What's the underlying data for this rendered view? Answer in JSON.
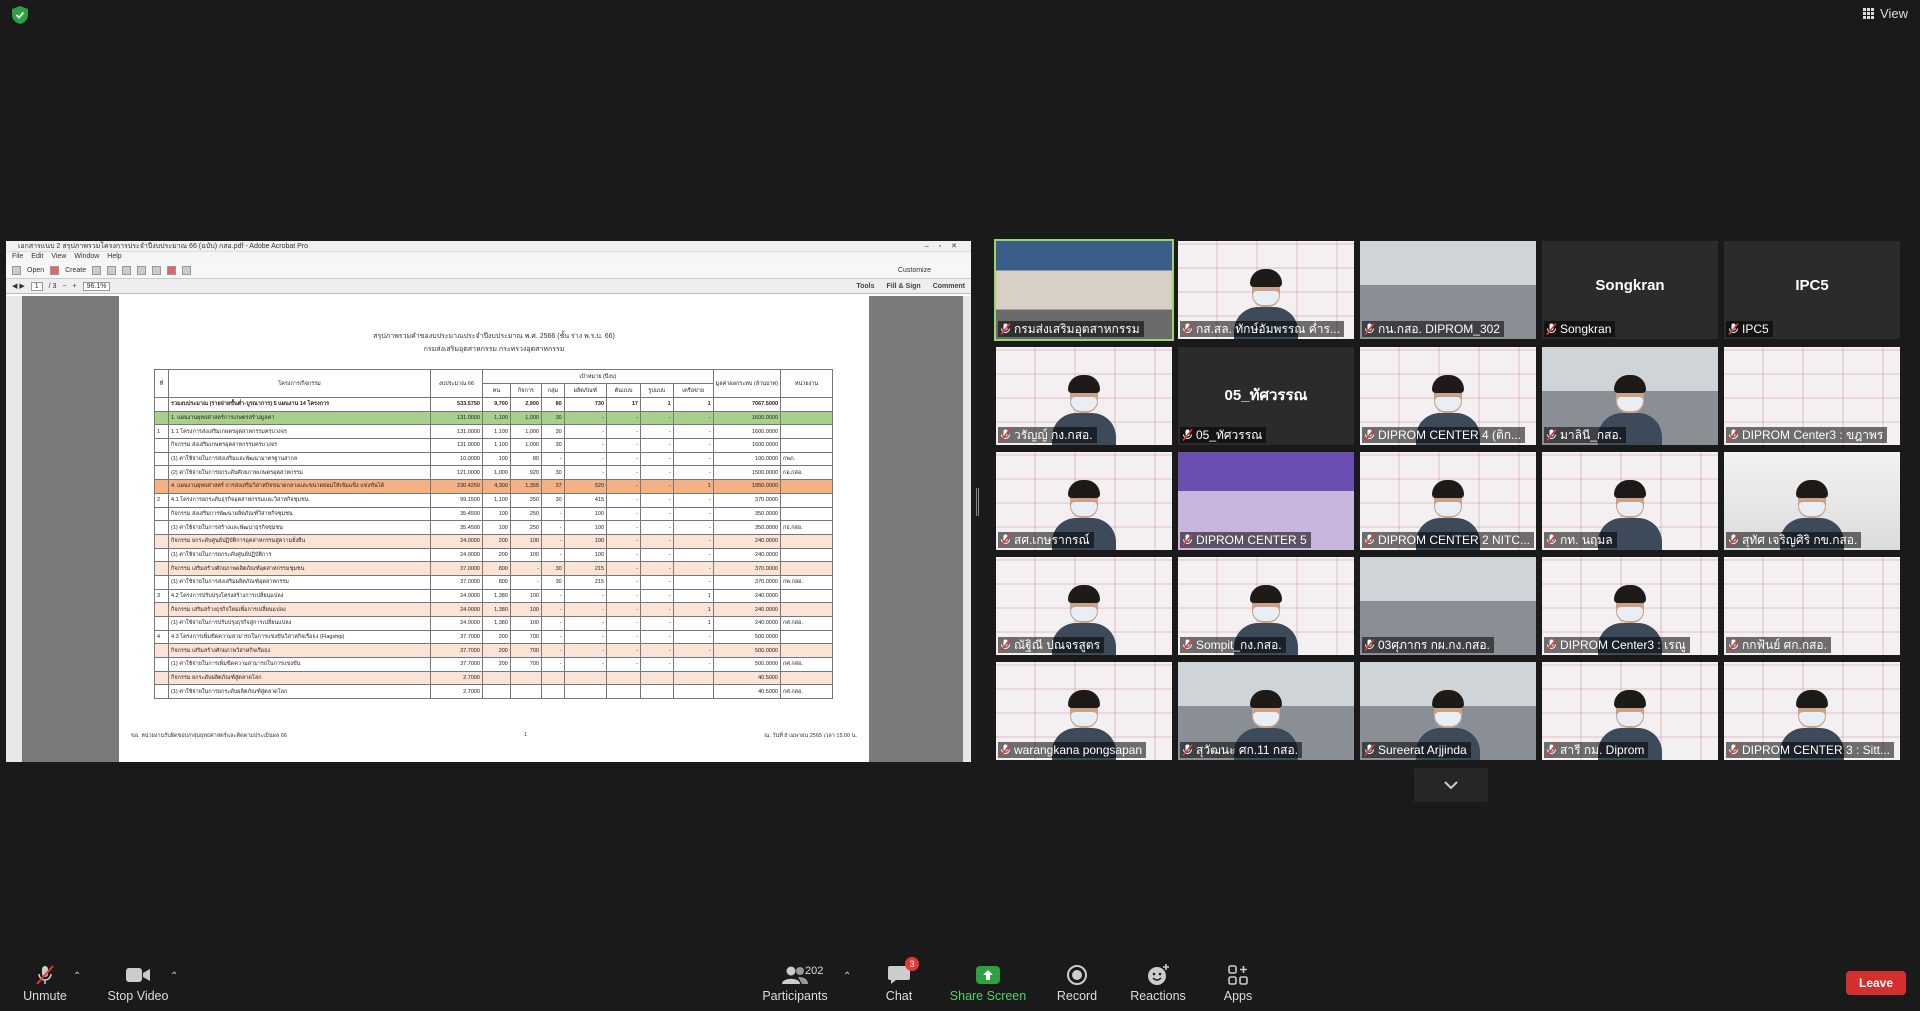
{
  "top": {
    "view_label": "View",
    "accent": "#2ea043"
  },
  "acrobat": {
    "title": "เอกสารแนบ 2 สรุปภาพรวมโครงการประจำปีงบประมาณ 66 (ฉบับ) กสอ.pdf - Adobe Acrobat Pro",
    "menu": [
      "File",
      "Edit",
      "View",
      "Window",
      "Help"
    ],
    "open_label": "Open",
    "create_label": "Create",
    "customize_label": "Customize",
    "page_current": "1",
    "page_total": "/ 3",
    "zoom": "96.1%",
    "tabs": [
      "Tools",
      "Fill & Sign",
      "Comment"
    ]
  },
  "document": {
    "title1": "สรุปภาพรวมคำของบประมาณประจำปีงบประมาณ พ.ศ. 2566 (ชั้น ร่าง พ.ร.บ. 66)",
    "title2": "กรมส่งเสริมอุตสาหกรรม กระทรวงอุตสาหกรรม",
    "headers": {
      "no": "ที่",
      "name": "โครงการ/กิจกรรม",
      "budget": "งบประมาณ 66",
      "target": "เป้าหมาย (ปีงบ)",
      "benefit": "มูลค่าผลกระทบ (ล้านบาท)",
      "unit": "หน่วยงาน",
      "subs": [
        "คน",
        "กิจการ",
        "กลุ่ม",
        "ผลิตภัณฑ์",
        "ต้นแบบ",
        "รูปแบบ",
        "เครือข่าย"
      ]
    },
    "rows": [
      {
        "cls": "t",
        "no": "",
        "name": "รวมงบประมาณ (รายจ่ายขั้นต่ำ-บูรณาการ) 5 แผนงาน 14 โครงการ",
        "budget": "533.5750",
        "v": [
          "9,700",
          "2,900",
          "80",
          "730",
          "17",
          "1",
          "1"
        ],
        "benefit": "7067.5000",
        "unit": ""
      },
      {
        "cls": "g",
        "no": "",
        "name": "1. แผนงานยุทธศาสตร์การเกษตรสร้างมูลค่า",
        "budget": "131.0000",
        "v": [
          "1,100",
          "1,000",
          "30",
          "-",
          "-",
          "-",
          "-"
        ],
        "benefit": "1600.0000",
        "unit": ""
      },
      {
        "cls": "",
        "no": "1",
        "name": "1.1 โครงการส่งเสริมเกษตรอุตสาหกรรมครบวงจร",
        "budget": "131.0000",
        "v": [
          "1,100",
          "1,000",
          "30",
          "-",
          "-",
          "-",
          "-"
        ],
        "benefit": "1600.0000",
        "unit": ""
      },
      {
        "cls": "",
        "no": "",
        "name": "กิจกรรม ส่งเสริมเกษตรอุตสาหกรรมครบวงจร",
        "budget": "131.0000",
        "v": [
          "1,100",
          "1,000",
          "30",
          "-",
          "-",
          "-",
          "-"
        ],
        "benefit": "1600.0000",
        "unit": ""
      },
      {
        "cls": "",
        "no": "",
        "name": "(1) ค่าใช้จ่ายในการส่งเสริมและพัฒนามาตรฐานสากล",
        "budget": "10.0000",
        "v": [
          "100",
          "80",
          "-",
          "-",
          "-",
          "-",
          "-"
        ],
        "benefit": "100.0000",
        "unit": "กพภ."
      },
      {
        "cls": "",
        "no": "",
        "name": "(2) ค่าใช้จ่ายในการยกระดับศักยภาพเกษตรอุตสาหกรรม",
        "budget": "121.0000",
        "v": [
          "1,000",
          "920",
          "30",
          "-",
          "-",
          "-",
          "-"
        ],
        "benefit": "1500.0000",
        "unit": "กอ.กสอ."
      },
      {
        "cls": "o",
        "no": "",
        "name": "4. แผนงานยุทธศาสตร์ การส่งเสริมวิสาหกิจขนาดกลางและขนาดย่อมให้เข้มแข็ง แข่งขันได้",
        "budget": "230.4250",
        "v": [
          "4,300",
          "1,355",
          "37",
          "520",
          "-",
          "-",
          "1"
        ],
        "benefit": "1950.0000",
        "unit": ""
      },
      {
        "cls": "",
        "no": "2",
        "name": "4.1 โครงการยกระดับธุรกิจอุตสาหกรรมและวิสาหกิจชุมชน",
        "budget": "99.1500",
        "v": [
          "1,100",
          "350",
          "30",
          "415",
          "-",
          "-",
          "-"
        ],
        "benefit": "370.0000",
        "unit": ""
      },
      {
        "cls": "",
        "no": "",
        "name": "กิจกรรม ส่งเสริมการพัฒนาผลิตภัณฑ์วิสาหกิจชุมชน",
        "budget": "35.4500",
        "v": [
          "100",
          "250",
          "-",
          "100",
          "-",
          "-",
          "-"
        ],
        "benefit": "350.0000",
        "unit": ""
      },
      {
        "cls": "",
        "no": "",
        "name": "(1) ค่าใช้จ่ายในการสร้างและพัฒนาธุรกิจชุมชน",
        "budget": "35.4500",
        "v": [
          "100",
          "250",
          "-",
          "100",
          "-",
          "-",
          "-"
        ],
        "benefit": "350.0000",
        "unit": "กธ.กสอ."
      },
      {
        "cls": "p",
        "no": "",
        "name": "กิจกรรม ยกระดับศูนย์ปฏิบัติการอุตสาหกรรมสู่ความยั่งยืน",
        "budget": "24.0000",
        "v": [
          "200",
          "100",
          "-",
          "100",
          "-",
          "-",
          "-"
        ],
        "benefit": "240.0000",
        "unit": ""
      },
      {
        "cls": "",
        "no": "",
        "name": "(1) ค่าใช้จ่ายในการยกระดับศูนย์ปฏิบัติการ",
        "budget": "24.0000",
        "v": [
          "200",
          "100",
          "-",
          "100",
          "-",
          "-",
          "-"
        ],
        "benefit": "240.0000",
        "unit": ""
      },
      {
        "cls": "p",
        "no": "",
        "name": "กิจกรรม เสริมสร้างศักยภาพผลิตภัณฑ์อุตสาหกรรมชุมชน",
        "budget": "37.0000",
        "v": [
          "800",
          "-",
          "30",
          "215",
          "-",
          "-",
          "-"
        ],
        "benefit": "370.0000",
        "unit": ""
      },
      {
        "cls": "",
        "no": "",
        "name": "(1) ค่าใช้จ่ายในการส่งเสริมผลิตภัณฑ์อุตสาหกรรม",
        "budget": "37.0000",
        "v": [
          "800",
          "-",
          "30",
          "215",
          "-",
          "-",
          "-"
        ],
        "benefit": "370.0000",
        "unit": "กพ.กสอ."
      },
      {
        "cls": "",
        "no": "3",
        "name": "4.2 โครงการปรับปรุงโครงสร้างการเปลี่ยนแปลง",
        "budget": "24.0000",
        "v": [
          "1,380",
          "100",
          "-",
          "-",
          "-",
          "-",
          "1"
        ],
        "benefit": "240.0000",
        "unit": ""
      },
      {
        "cls": "p",
        "no": "",
        "name": "กิจกรรม เสริมสร้างธุรกิจใหม่เพื่อการเปลี่ยนแปลง",
        "budget": "24.0000",
        "v": [
          "1,380",
          "100",
          "-",
          "-",
          "-",
          "-",
          "1"
        ],
        "benefit": "240.0000",
        "unit": ""
      },
      {
        "cls": "",
        "no": "",
        "name": "(1) ค่าใช้จ่ายในการปรับปรุงธุรกิจสู่การเปลี่ยนแปลง",
        "budget": "24.0000",
        "v": [
          "1,380",
          "100",
          "-",
          "-",
          "-",
          "-",
          "1"
        ],
        "benefit": "240.0000",
        "unit": "กศ.กสอ."
      },
      {
        "cls": "",
        "no": "4",
        "name": "4.3 โครงการเพิ่มขีดความสามารถในการแข่งขันวิสาหกิจเรือธง (Flagship)",
        "budget": "37.7000",
        "v": [
          "200",
          "700",
          "-",
          "-",
          "-",
          "-",
          "-"
        ],
        "benefit": "500.0000",
        "unit": ""
      },
      {
        "cls": "p",
        "no": "",
        "name": "กิจกรรม เสริมสร้างศักยภาพวิสาหกิจเรือธง",
        "budget": "37.7000",
        "v": [
          "200",
          "700",
          "-",
          "-",
          "-",
          "-",
          "-"
        ],
        "benefit": "500.0000",
        "unit": ""
      },
      {
        "cls": "",
        "no": "",
        "name": "(1) ค่าใช้จ่ายในการเพิ่มขีดความสามารถในการแข่งขัน",
        "budget": "37.7000",
        "v": [
          "200",
          "700",
          "-",
          "-",
          "-",
          "-",
          "-"
        ],
        "benefit": "500.0000",
        "unit": "กศ.กสอ."
      },
      {
        "cls": "p",
        "no": "",
        "name": "กิจกรรม ยกระดับผลิตภัณฑ์สู่ตลาดโลก",
        "budget": "2.7000",
        "v": [
          "",
          "",
          "",
          "",
          "",
          "",
          ""
        ],
        "benefit": "40.5000",
        "unit": ""
      },
      {
        "cls": "",
        "no": "",
        "name": "(1) ค่าใช้จ่ายในการยกระดับผลิตภัณฑ์สู่ตลาดโลก",
        "budget": "2.7000",
        "v": [
          "",
          "",
          "",
          "",
          "",
          "",
          ""
        ],
        "benefit": "40.5000",
        "unit": "กศ.กสอ."
      }
    ],
    "footer_left": "ขอ. หน่วยงานรับผิดชอบ/กลุ่มยุทธศาสตร์และติดตามประเมินผล 66",
    "footer_mid": "1",
    "footer_right": "ณ. วันที่ 8 เมษายน 2565 เวลา 15.00 น."
  },
  "participants": [
    {
      "name": "กรมส่งเสริมอุตสาหกรรม",
      "bg": "room",
      "person": false,
      "active": true,
      "big": ""
    },
    {
      "name": "กส.สล. ทักษ์อัมพรรณ ค่ำร...",
      "bg": "logo",
      "person": true,
      "active": false,
      "big": ""
    },
    {
      "name": "กน.กสอ. DIPROM_302",
      "bg": "office",
      "person": false,
      "active": false,
      "big": ""
    },
    {
      "name": "Songkran",
      "bg": "dark",
      "person": false,
      "active": false,
      "big": "Songkran"
    },
    {
      "name": "IPC5",
      "bg": "dark",
      "person": false,
      "active": false,
      "big": "IPC5"
    },
    {
      "name": "วรัญญ์ กง.กสอ.",
      "bg": "logo",
      "person": true,
      "active": false,
      "big": ""
    },
    {
      "name": "05_ทัศวรรณ",
      "bg": "dark",
      "person": false,
      "active": false,
      "big": "05_ทัศวรรณ"
    },
    {
      "name": "DIPROM CENTER 4 (ติก...",
      "bg": "logo",
      "person": true,
      "active": false,
      "big": ""
    },
    {
      "name": "มาลินี_กสอ.",
      "bg": "office",
      "person": true,
      "active": false,
      "big": ""
    },
    {
      "name": "DIPROM Center3 : ขฎาพร",
      "bg": "logo",
      "person": false,
      "active": false,
      "big": ""
    },
    {
      "name": "สศ.เกษรากรณ์",
      "bg": "logo",
      "person": true,
      "active": false,
      "big": ""
    },
    {
      "name": "DIPROM CENTER 5",
      "bg": "purple",
      "person": false,
      "active": false,
      "big": ""
    },
    {
      "name": "DIPROM CENTER 2 NITC...",
      "bg": "logo",
      "person": true,
      "active": false,
      "big": ""
    },
    {
      "name": "กท. นฤมล",
      "bg": "logo",
      "person": true,
      "active": false,
      "big": ""
    },
    {
      "name": "สุทัศ เจริญศิริ กข.กสอ.",
      "bg": "wall",
      "person": true,
      "active": false,
      "big": ""
    },
    {
      "name": "ณัฐิณี ปณจรสูตร",
      "bg": "logo",
      "person": true,
      "active": false,
      "big": ""
    },
    {
      "name": "Sompit_กง.กสอ.",
      "bg": "logo",
      "person": true,
      "active": false,
      "big": ""
    },
    {
      "name": "03ศุภากร กผ.กง.กสอ.",
      "bg": "office",
      "person": false,
      "active": false,
      "big": ""
    },
    {
      "name": "DIPROM Center3 : เรณู",
      "bg": "logo",
      "person": true,
      "active": false,
      "big": ""
    },
    {
      "name": "กกฟ้นย์ ศก.กสอ.",
      "bg": "logo",
      "person": false,
      "active": false,
      "big": ""
    },
    {
      "name": "warangkana pongsapan",
      "bg": "logo",
      "person": true,
      "active": false,
      "big": ""
    },
    {
      "name": "สุวัฒนะ ศก.11 กสอ.",
      "bg": "office",
      "person": true,
      "active": false,
      "big": ""
    },
    {
      "name": "Sureerat Arjjinda",
      "bg": "office",
      "person": true,
      "active": false,
      "big": ""
    },
    {
      "name": "สารี กม. Diprom",
      "bg": "logo",
      "person": true,
      "active": false,
      "big": ""
    },
    {
      "name": "DIPROM CENTER 3 : Sitt...",
      "bg": "logo",
      "person": true,
      "active": false,
      "big": ""
    }
  ],
  "toolbar": {
    "unmute": "Unmute",
    "stop_video": "Stop Video",
    "participants": "Participants",
    "participants_count": "202",
    "chat": "Chat",
    "chat_badge": "3",
    "share": "Share Screen",
    "record": "Record",
    "reactions": "Reactions",
    "apps": "Apps",
    "leave": "Leave",
    "leave_color": "#d32f2f",
    "share_color": "#2ea043"
  }
}
